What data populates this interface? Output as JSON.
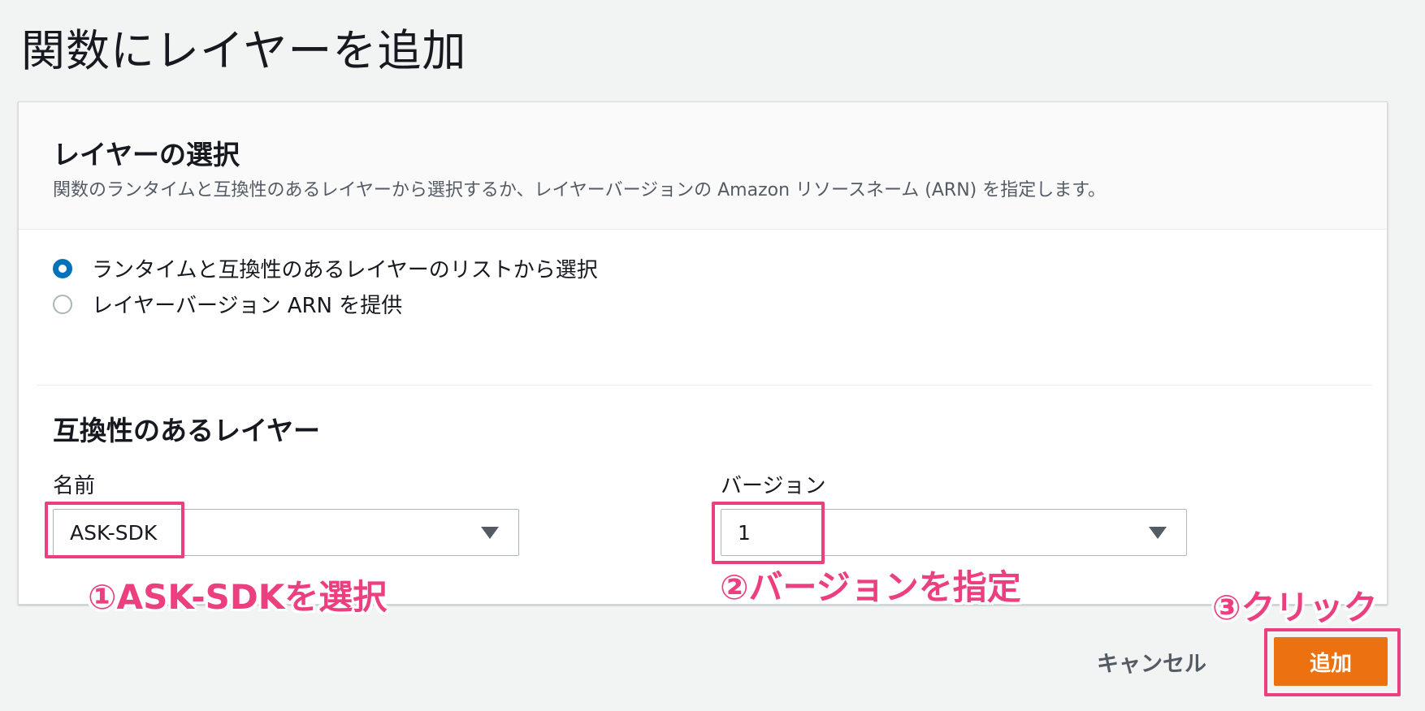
{
  "page": {
    "title": "関数にレイヤーを追加"
  },
  "layer_selection": {
    "heading": "レイヤーの選択",
    "description": "関数のランタイムと互換性のあるレイヤーから選択するか、レイヤーバージョンの Amazon リソースネーム (ARN) を指定します。",
    "options": [
      {
        "label": "ランタイムと互換性のあるレイヤーのリストから選択",
        "selected": true
      },
      {
        "label": "レイヤーバージョン ARN を提供",
        "selected": false
      }
    ]
  },
  "compatible_layers": {
    "heading": "互換性のあるレイヤー",
    "name_label": "名前",
    "name_value": "ASK-SDK",
    "version_label": "バージョン",
    "version_value": "1"
  },
  "annotations": {
    "step1": "①ASK-SDKを選択",
    "step2": "②バージョンを指定",
    "step3": "③クリック"
  },
  "footer": {
    "cancel_label": "キャンセル",
    "add_label": "追加"
  },
  "colors": {
    "accent": "#0073bb",
    "primary_button": "#ec7211",
    "annotation": "#ec3f80"
  }
}
